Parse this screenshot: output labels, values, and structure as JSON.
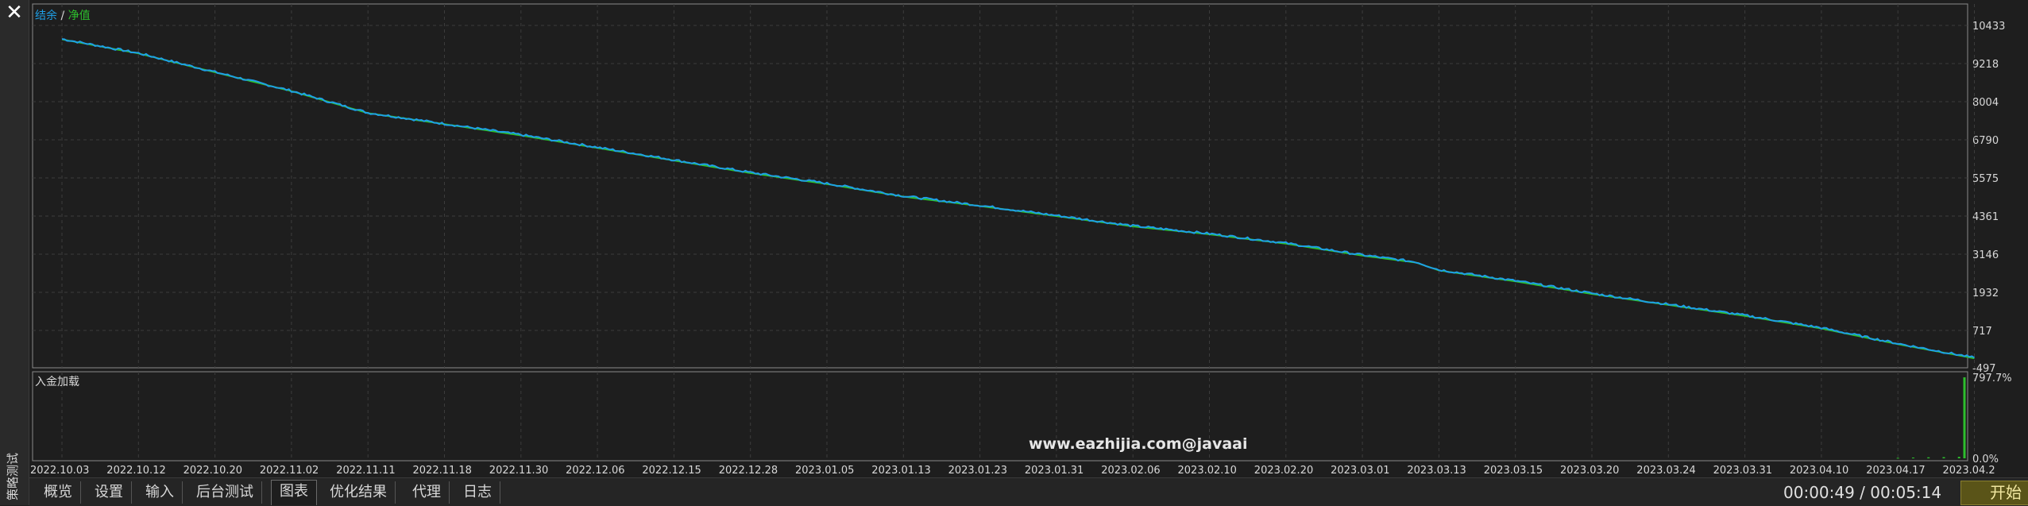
{
  "window": {
    "side_title": "策略测试",
    "close_icon": "close-icon"
  },
  "legend": {
    "balance_label": "结余",
    "separator": "/",
    "equity_label": "净值",
    "balance_color": "#1e9fe6",
    "equity_color": "#2dbf2d"
  },
  "sub_panel": {
    "title": "入金加载"
  },
  "watermark": "www.eazhijia.com@javaai",
  "tabs": [
    {
      "label": "概览",
      "active": false
    },
    {
      "label": "设置",
      "active": false
    },
    {
      "label": "输入",
      "active": false
    },
    {
      "label": "后台测试",
      "active": false
    },
    {
      "label": "图表",
      "active": true
    },
    {
      "label": "优化结果",
      "active": false
    },
    {
      "label": "代理",
      "active": false
    },
    {
      "label": "日志",
      "active": false
    }
  ],
  "status": {
    "timer": "00:00:49 / 00:05:14",
    "start_button": "开始",
    "start_color": "#5a5418"
  },
  "chart_data": [
    {
      "type": "line",
      "title": "",
      "legend": [
        "结余",
        "净值"
      ],
      "x_tick_labels": [
        "2022.10.03",
        "2022.10.12",
        "2022.10.20",
        "2022.11.02",
        "2022.11.11",
        "2022.11.18",
        "2022.11.30",
        "2022.12.06",
        "2022.12.15",
        "2022.12.28",
        "2023.01.05",
        "2023.01.13",
        "2023.01.23",
        "2023.01.31",
        "2023.02.06",
        "2023.02.10",
        "2023.02.20",
        "2023.03.01",
        "2023.03.13",
        "2023.03.15",
        "2023.03.20",
        "2023.03.24",
        "2023.03.31",
        "2023.04.10",
        "2023.04.17",
        "2023.04.2"
      ],
      "y_tick_labels": [
        "10433",
        "9218",
        "8004",
        "6790",
        "5575",
        "4361",
        "3146",
        "1932",
        "717",
        "-497"
      ],
      "ylim": [
        -497,
        10433
      ],
      "grid": true,
      "series": [
        {
          "name": "结余",
          "color": "#1e9fe6",
          "x_index": [
            0,
            1,
            2,
            3,
            4,
            5,
            6,
            7,
            8,
            9,
            10,
            11,
            12,
            13,
            14,
            15,
            16,
            17,
            17.7,
            18,
            19,
            20,
            21,
            22,
            23,
            24,
            25
          ],
          "values": [
            10000,
            9550,
            8950,
            8350,
            7650,
            7300,
            6950,
            6550,
            6150,
            5750,
            5400,
            5000,
            4700,
            4380,
            4050,
            3800,
            3500,
            3120,
            2900,
            2650,
            2300,
            1900,
            1550,
            1200,
            800,
            300,
            -150
          ]
        },
        {
          "name": "净值",
          "color": "#2dbf2d",
          "x_index": [
            0,
            1,
            2,
            3,
            4,
            5,
            6,
            7,
            8,
            9,
            10,
            11,
            12,
            13,
            14,
            15,
            16,
            17,
            17.7,
            18,
            19,
            20,
            21,
            22,
            23,
            24,
            25
          ],
          "values": [
            9990,
            9540,
            8940,
            8340,
            7640,
            7290,
            6930,
            6530,
            6130,
            5730,
            5380,
            4980,
            4680,
            4360,
            4030,
            3780,
            3480,
            3100,
            2880,
            2630,
            2280,
            1880,
            1530,
            1180,
            780,
            280,
            -170
          ]
        }
      ]
    },
    {
      "type": "bar",
      "title": "入金加载",
      "y_tick_labels": [
        "797.7%",
        "0.0%"
      ],
      "ylim": [
        0,
        797.7
      ],
      "series": [
        {
          "name": "入金加载",
          "color": "#2dbf2d",
          "x_index": [
            24.0,
            24.2,
            24.4,
            24.6,
            24.8,
            25.0
          ],
          "values": [
            5,
            8,
            10,
            12,
            15,
            797.7
          ]
        }
      ]
    }
  ]
}
